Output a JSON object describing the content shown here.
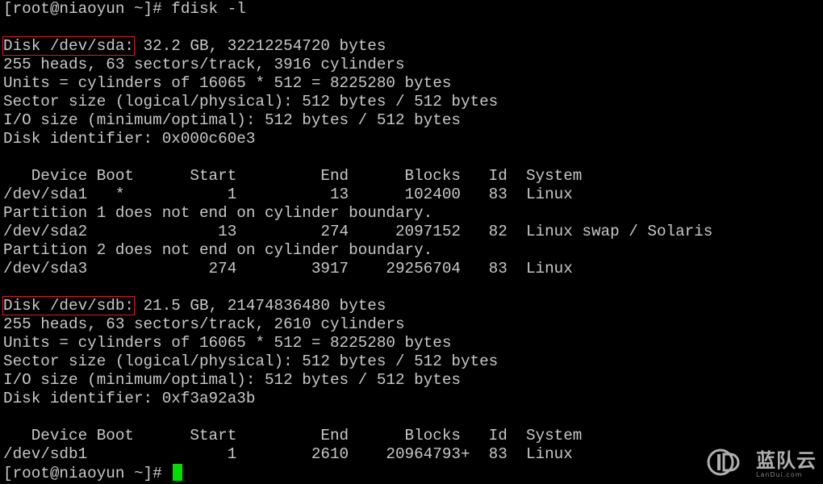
{
  "theme": {
    "background": "#000000",
    "foreground": "#c8c8c8",
    "highlight_border": "#d42020",
    "cursor_color": "#00e000"
  },
  "terminal": {
    "lines": [
      "[root@niaoyun ~]# fdisk -l",
      "",
      "Disk /dev/sda: 32.2 GB, 32212254720 bytes",
      "255 heads, 63 sectors/track, 3916 cylinders",
      "Units = cylinders of 16065 * 512 = 8225280 bytes",
      "Sector size (logical/physical): 512 bytes / 512 bytes",
      "I/O size (minimum/optimal): 512 bytes / 512 bytes",
      "Disk identifier: 0x000c60e3",
      "",
      "   Device Boot      Start         End      Blocks   Id  System",
      "/dev/sda1   *           1          13      102400   83  Linux",
      "Partition 1 does not end on cylinder boundary.",
      "/dev/sda2              13         274     2097152   82  Linux swap / Solaris",
      "Partition 2 does not end on cylinder boundary.",
      "/dev/sda3             274        3917    29256704   83  Linux",
      "",
      "Disk /dev/sdb: 21.5 GB, 21474836480 bytes",
      "255 heads, 63 sectors/track, 2610 cylinders",
      "Units = cylinders of 16065 * 512 = 8225280 bytes",
      "Sector size (logical/physical): 512 bytes / 512 bytes",
      "I/O size (minimum/optimal): 512 bytes / 512 bytes",
      "Disk identifier: 0xf3a92a3b",
      "",
      "   Device Boot      Start         End      Blocks   Id  System",
      "/dev/sdb1               1        2610    20964793+  83  Linux"
    ],
    "highlights": {
      "sda_label": "Disk /dev/sda:",
      "sda_rest": " 32.2 GB, 32212254720 bytes",
      "sdb_label": "Disk /dev/sdb:",
      "sdb_rest": " 21.5 GB, 21474836480 bytes"
    },
    "prompt": "[root@niaoyun ~]# "
  },
  "watermark": {
    "name_cn": "蓝队云",
    "name_en": "LanDui.com",
    "icon": "landui-logo-icon"
  }
}
